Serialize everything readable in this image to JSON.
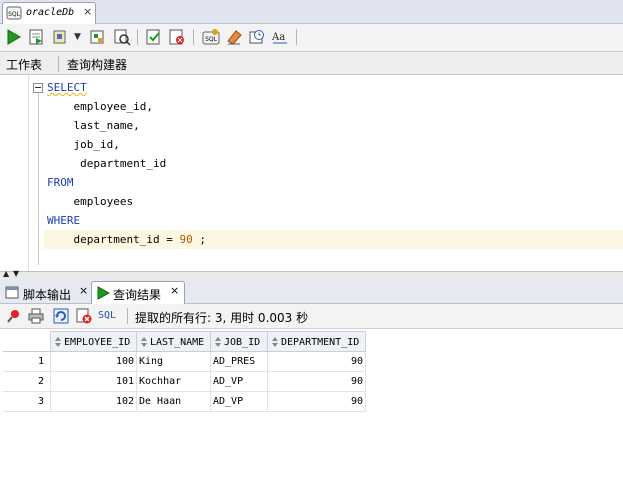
{
  "document_tab": {
    "title": "oracleDb",
    "close": "×"
  },
  "subtabs": {
    "worksheet": "工作表",
    "query_builder": "查询构建器"
  },
  "editor": {
    "lines": [
      "SELECT",
      "    employee_id,",
      "    last_name,",
      "    job_id,",
      "     department_id",
      "FROM",
      "    employees",
      "WHERE",
      "    department_id = ",
      "90",
      " ;"
    ]
  },
  "result_tabs": [
    {
      "label": "脚本输出",
      "close": "×"
    },
    {
      "label": "查询结果",
      "close": "×"
    }
  ],
  "result_toolbar": {
    "sql_label": "SQL",
    "status": "提取的所有行: 3, 用时 0.003 秒"
  },
  "grid": {
    "columns": [
      "EMPLOYEE_ID",
      "LAST_NAME",
      "JOB_ID",
      "DEPARTMENT_ID"
    ],
    "rows": [
      {
        "n": "1",
        "cells": [
          "100",
          "King",
          "AD_PRES",
          "90"
        ]
      },
      {
        "n": "2",
        "cells": [
          "101",
          "Kochhar",
          "AD_VP",
          "90"
        ]
      },
      {
        "n": "3",
        "cells": [
          "102",
          "De Haan",
          "AD_VP",
          "90"
        ]
      }
    ]
  },
  "colors": {
    "keyword": "#1a3fb5",
    "number": "#b05a00",
    "run_green": "#1d9a1d",
    "current_line": "#fdf6e3"
  }
}
